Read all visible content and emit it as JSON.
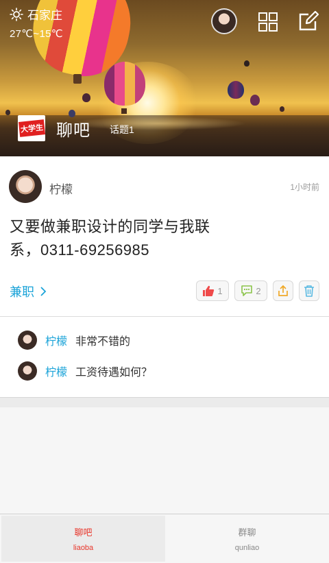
{
  "header": {
    "city": "石家庄",
    "temperature": "27℃~15℃",
    "brand_logo_text": "大学生",
    "section_title": "聊吧",
    "topic_count": "话题1",
    "icons": [
      "sun-icon",
      "avatar",
      "grid-icon",
      "edit-icon"
    ]
  },
  "post": {
    "author": "柠檬",
    "time": "1小时前",
    "text": "又要做兼职设计的同学与我联系，0311-69256985",
    "tag": "兼职",
    "like_count": "1",
    "comment_count": "2",
    "colors": {
      "tag": "#1aa3d8",
      "like_icon": "#ef4a4a",
      "comment_icon": "#8bc34a",
      "share_icon": "#f0a928",
      "delete_icon": "#58b9e2"
    }
  },
  "comments": [
    {
      "name": "柠檬",
      "text": "非常不错的"
    },
    {
      "name": "柠檬",
      "text": "工资待遇如何？"
    }
  ],
  "tabs": [
    {
      "label": "聊吧",
      "sub": "liaoba",
      "active": true
    },
    {
      "label": "群聊",
      "sub": "qunliao",
      "active": false
    }
  ],
  "colors": {
    "active_tab": "#e8352a",
    "inactive_tab": "#888888"
  }
}
